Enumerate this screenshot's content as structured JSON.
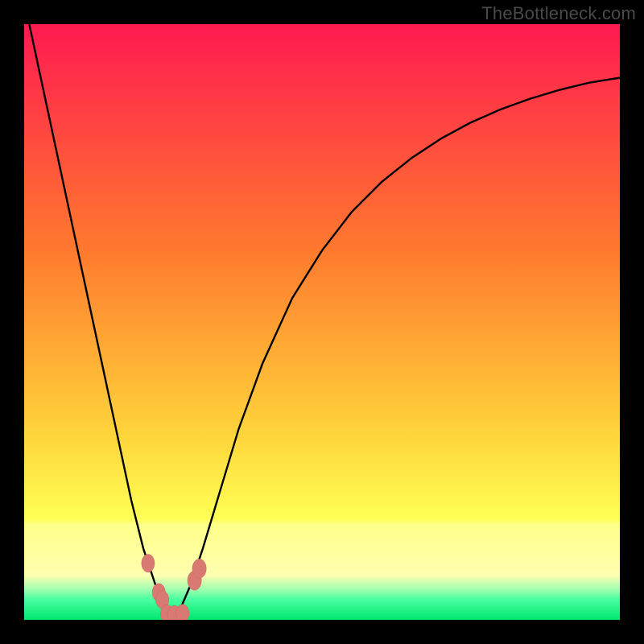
{
  "watermark": "TheBottleneck.com",
  "colors": {
    "gradient_top": "#ff1a50",
    "gradient_mid1": "#ff7a2e",
    "gradient_mid2": "#ffd23a",
    "gradient_yellowband": "#ffff8a",
    "gradient_green": "#00e76f",
    "curve": "#000000",
    "marker_fill": "#d97a72",
    "marker_stroke": "#c86a62",
    "frame": "#000000"
  },
  "chart_data": {
    "type": "line",
    "title": "",
    "xlabel": "",
    "ylabel": "",
    "xlim": [
      0,
      100
    ],
    "ylim": [
      0,
      100
    ],
    "legend": false,
    "grid": false,
    "annotations": [],
    "series": [
      {
        "name": "bottleneck-curve",
        "x": [
          0,
          3,
          6,
          9,
          12,
          15,
          18,
          20,
          22,
          23.5,
          25,
          26.5,
          28,
          30,
          33,
          36,
          40,
          45,
          50,
          55,
          60,
          65,
          70,
          75,
          80,
          85,
          90,
          95,
          100
        ],
        "y": [
          104,
          90,
          76,
          62,
          48,
          34,
          20,
          12,
          6,
          2.5,
          1,
          2.5,
          6,
          12,
          22,
          32,
          43,
          54,
          62,
          68.5,
          73.5,
          77.5,
          80.8,
          83.5,
          85.7,
          87.5,
          89,
          90.2,
          91
        ]
      }
    ],
    "markers": [
      {
        "name": "left-upper-dot",
        "x": 20.8,
        "y": 9.5,
        "r": 1.4
      },
      {
        "name": "left-cluster-1",
        "x": 22.6,
        "y": 4.6,
        "r": 1.4
      },
      {
        "name": "left-cluster-2",
        "x": 23.2,
        "y": 3.4,
        "r": 1.4
      },
      {
        "name": "bottom-lobe-left",
        "x": 24.0,
        "y": 1.0,
        "r": 1.4
      },
      {
        "name": "bottom-lobe-mid",
        "x": 25.2,
        "y": 0.9,
        "r": 1.4
      },
      {
        "name": "bottom-lobe-right",
        "x": 26.6,
        "y": 1.1,
        "r": 1.4
      },
      {
        "name": "right-cluster-1",
        "x": 28.6,
        "y": 6.6,
        "r": 1.5
      },
      {
        "name": "right-cluster-2",
        "x": 29.4,
        "y": 8.6,
        "r": 1.5
      }
    ]
  }
}
